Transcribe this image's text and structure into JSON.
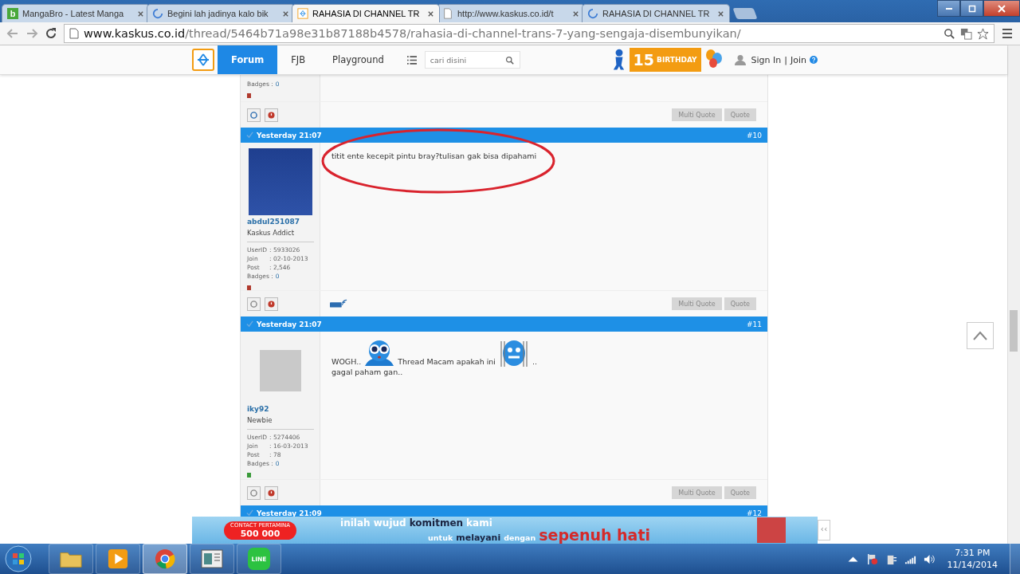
{
  "browser": {
    "tabs": [
      {
        "title": "MangaBro - Latest Manga",
        "kind": "letter",
        "favicon_text": "b",
        "selected": false
      },
      {
        "title": "Begini lah jadinya kalo bik",
        "kind": "loading",
        "selected": false
      },
      {
        "title": "RAHASIA DI CHANNEL TR",
        "kind": "kaskus",
        "selected": true
      },
      {
        "title": "http://www.kaskus.co.id/t",
        "kind": "page",
        "selected": false
      },
      {
        "title": "RAHASIA DI CHANNEL TR",
        "kind": "loading",
        "selected": false
      }
    ],
    "url_host": "www.kaskus.co.id",
    "url_path": "/thread/5464b71a98e31b87188b4578/rahasia-di-channel-trans-7-yang-sengaja-disembunyikan/"
  },
  "site_nav": {
    "items": [
      {
        "label": "Forum",
        "selected": true
      },
      {
        "label": "FJB",
        "selected": false
      },
      {
        "label": "Playground",
        "selected": false
      }
    ],
    "search_placeholder": "cari disini",
    "birthday_number": "15",
    "birthday_label": "BIRTHDAY",
    "sign_in": "Sign In",
    "separator": "|",
    "join": "Join"
  },
  "partial_post": {
    "stats": [
      {
        "label": "Badges :",
        "value": "0",
        "link": true
      }
    ],
    "color": "#b03a2e",
    "buttons": [
      "Multi Quote",
      "Quote"
    ]
  },
  "posts": [
    {
      "time": "Yesterday 21:07",
      "number": "#10",
      "username": "abdul251087",
      "rank": "Kaskus Addict",
      "stats": [
        {
          "label": "UserID",
          "value": ": 5933026",
          "link": false
        },
        {
          "label": "Join",
          "value": ": 02-10-2013",
          "link": false
        },
        {
          "label": "Post",
          "value": ": 2,546",
          "link": false
        },
        {
          "label": "Badges :",
          "value": "0",
          "link": true
        }
      ],
      "color": "#b03a2e",
      "lines": [
        [
          {
            "kind": "text",
            "text": "titit ente kecepit pintu bray?tulisan gak bisa dipahami"
          }
        ]
      ],
      "annotation": {
        "kind": "ellipse",
        "color": "#d9232d"
      },
      "wap": true,
      "buttons": [
        "Multi Quote",
        "Quote"
      ]
    },
    {
      "time": "Yesterday 21:07",
      "number": "#11",
      "username": "iky92",
      "rank": "Newbie",
      "stats": [
        {
          "label": "UserID",
          "value": ": 5274406",
          "link": false
        },
        {
          "label": "Join",
          "value": ": 16-03-2013",
          "link": false
        },
        {
          "label": "Post",
          "value": ": 78",
          "link": false
        },
        {
          "label": "Badges :",
          "value": "0",
          "link": true
        }
      ],
      "color": "#3a9a3a",
      "lines": [
        [
          {
            "kind": "text",
            "text": "WOGH.."
          },
          {
            "kind": "emoticon-eyes"
          },
          {
            "kind": "text",
            "text": "Thread Macam apakah ini"
          },
          {
            "kind": "emoticon-bars"
          },
          {
            "kind": "text",
            "text": ".."
          }
        ],
        [
          {
            "kind": "text",
            "text": "gagal paham gan.."
          }
        ]
      ],
      "wap": false,
      "buttons": [
        "Multi Quote",
        "Quote"
      ]
    }
  ],
  "next_post": {
    "time": "Yesterday 21:09",
    "number": "#12"
  },
  "banner": {
    "hotline_label": "CONTACT PERTAMINA",
    "hotline_number": "500 000",
    "lines": [
      [
        {
          "text": "inilah wujud",
          "kind": "plain"
        },
        {
          "text": "komitmen",
          "kind": "emphasis"
        },
        {
          "text": "kami",
          "kind": "plain"
        }
      ],
      [
        {
          "text": "untuk",
          "kind": "plain"
        },
        {
          "text": "melayani",
          "kind": "emphasis"
        },
        {
          "text": "dengan",
          "kind": "plain"
        },
        {
          "text": "sepenuh hati",
          "kind": "highlight"
        }
      ]
    ],
    "collapse": "‹‹"
  },
  "taskbar": {
    "apps": [
      {
        "kind": "folder",
        "active": false
      },
      {
        "kind": "media",
        "active": false
      },
      {
        "kind": "chrome",
        "active": true
      },
      {
        "kind": "reader",
        "active": false
      },
      {
        "kind": "line",
        "label": "LINE",
        "active": false
      }
    ],
    "time": "7:31 PM",
    "date": "11/14/2014"
  }
}
